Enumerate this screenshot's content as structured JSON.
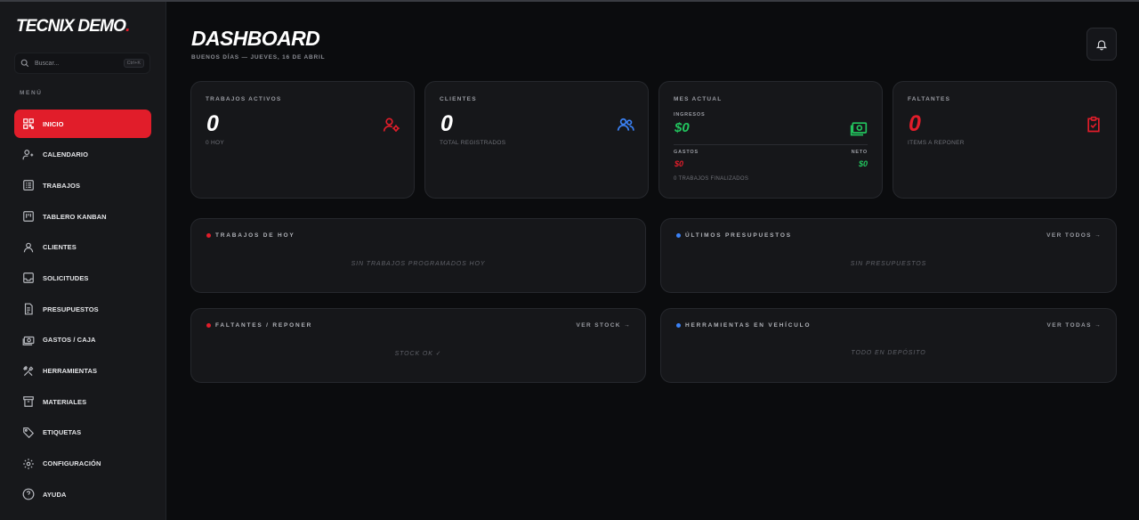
{
  "brand": {
    "name": "TECNIX DEMO",
    "dot": "."
  },
  "search": {
    "placeholder": "Buscar...",
    "shortcut": "Ctrl+K"
  },
  "menu_label": "MENÚ",
  "nav": [
    {
      "label": "INICIO",
      "icon": "dashboard-icon",
      "active": true
    },
    {
      "label": "CALENDARIO",
      "icon": "user-calendar-icon"
    },
    {
      "label": "TRABAJOS",
      "icon": "list-icon"
    },
    {
      "label": "TABLERO KANBAN",
      "icon": "kanban-icon"
    },
    {
      "label": "CLIENTES",
      "icon": "user-icon"
    },
    {
      "label": "SOLICITUDES",
      "icon": "inbox-icon"
    },
    {
      "label": "PRESUPUESTOS",
      "icon": "document-icon"
    },
    {
      "label": "GASTOS / CAJA",
      "icon": "cash-icon"
    },
    {
      "label": "HERRAMIENTAS",
      "icon": "tools-icon"
    },
    {
      "label": "MATERIALES",
      "icon": "archive-icon"
    },
    {
      "label": "ETIQUETAS",
      "icon": "tag-icon"
    },
    {
      "label": "CONFIGURACIÓN",
      "icon": "gear-icon"
    },
    {
      "label": "AYUDA",
      "icon": "help-icon"
    }
  ],
  "header": {
    "title": "DASHBOARD",
    "subtitle": "BUENOS DÍAS — JUEVES, 16 DE ABRIL"
  },
  "colors": {
    "accent": "#e11d2a",
    "blue": "#3b82f6",
    "green": "#22c55e"
  },
  "stats": {
    "active_jobs": {
      "title": "TRABAJOS ACTIVOS",
      "value": "0",
      "sub": "0 HOY"
    },
    "clients": {
      "title": "CLIENTES",
      "value": "0",
      "sub": "TOTAL REGISTRADOS"
    },
    "month": {
      "title": "MES ACTUAL",
      "income_label": "INGRESOS",
      "income": "$0",
      "expenses_label": "GASTOS",
      "expenses": "$0",
      "net_label": "NETO",
      "net": "$0",
      "finished": "0 TRABAJOS FINALIZADOS"
    },
    "missing": {
      "title": "FALTANTES",
      "value": "0",
      "sub": "ITEMS A REPONER"
    }
  },
  "panels": {
    "today_jobs": {
      "title": "TRABAJOS DE HOY",
      "empty": "SIN TRABAJOS PROGRAMADOS HOY"
    },
    "quotes": {
      "title": "ÚLTIMOS PRESUPUESTOS",
      "link": "VER TODOS →",
      "empty": "SIN PRESUPUESTOS"
    },
    "missing": {
      "title": "FALTANTES / REPONER",
      "link": "VER STOCK →",
      "empty": "STOCK OK ✓"
    },
    "tools": {
      "title": "HERRAMIENTAS EN VEHÍCULO",
      "link": "VER TODAS →",
      "empty": "TODO EN DEPÓSITO"
    }
  }
}
